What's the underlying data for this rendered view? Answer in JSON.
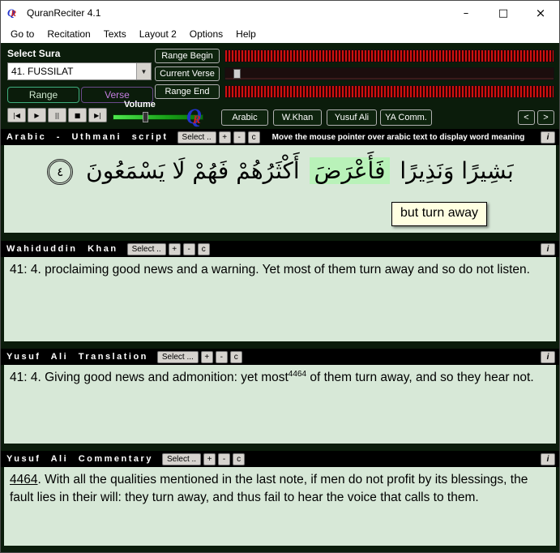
{
  "window": {
    "title": "QuranReciter 4.1",
    "minimize": "–",
    "maximize": "□",
    "close": "×"
  },
  "menu": [
    "Go to",
    "Recitation",
    "Texts",
    "Layout 2",
    "Options",
    "Help"
  ],
  "controls": {
    "select_sura_label": "Select Sura",
    "sura_value": "41. FUSSILAT",
    "dropdown_arrow": "▼",
    "range_tab": "Range",
    "verse_tab": "Verse",
    "range_begin": "Range Begin",
    "current_verse": "Current Verse",
    "range_end": "Range End",
    "volume_label": "Volume",
    "transport": [
      "|◀",
      "▶",
      "||",
      "■",
      "▶|"
    ],
    "view_buttons": [
      "Arabic",
      "W.Khan",
      "Yusuf Ali",
      "YA Comm."
    ],
    "prev": "<",
    "next": ">",
    "logo_q": "Q",
    "logo_r": "R"
  },
  "sections": {
    "arabic": {
      "title": "Arabic - Uthmani script",
      "select": "Select ..",
      "plus": "+",
      "minus": "-",
      "c": "c",
      "info": "i",
      "hint": "Move the mouse pointer over arabic text to display word meaning",
      "text_before": "بَشِيرًا وَنَذِيرًا",
      "highlight": "فَأَعْرَضَ",
      "text_after": "أَكْثَرُهُمْ فَهُمْ لَا يَسْمَعُونَ",
      "verse_marker": "٤",
      "tooltip": "but turn away"
    },
    "wkhan": {
      "title": "Wahiduddin Khan",
      "select": "Select ..",
      "plus": "+",
      "minus": "-",
      "c": "c",
      "info": "i",
      "text": "41: 4. proclaiming good news and a warning. Yet most of them turn away and so do not listen."
    },
    "yusufali": {
      "title": "Yusuf Ali Translation",
      "select": "Select ...",
      "plus": "+",
      "minus": "-",
      "c": "c",
      "info": "i",
      "text_before": "41: 4. Giving good news and admonition: yet most",
      "footnote_ref": "4464",
      "text_after": " of them turn away, and so they hear not."
    },
    "commentary": {
      "title": "Yusuf Ali Commentary",
      "select": "Select ..",
      "plus": "+",
      "minus": "-",
      "c": "c",
      "info": "i",
      "footnote_num": "4464",
      "text": ". With all the qualities mentioned in the last note, if men do not profit by its blessings, the fault lies in their will: they turn away, and thus fail to hear the voice that calls to them."
    }
  },
  "colors": {
    "panel_dark": "#0b1c0b",
    "panel_light": "#d7e8d7",
    "highlight_green": "#b9f2b9",
    "tooltip_bg": "#ffffe1",
    "stripe_red": "#d01010",
    "stripe_dark": "#2a0202",
    "volume_green": "#18a018",
    "logo_blue": "#2233cc",
    "logo_red": "#cc2222"
  }
}
